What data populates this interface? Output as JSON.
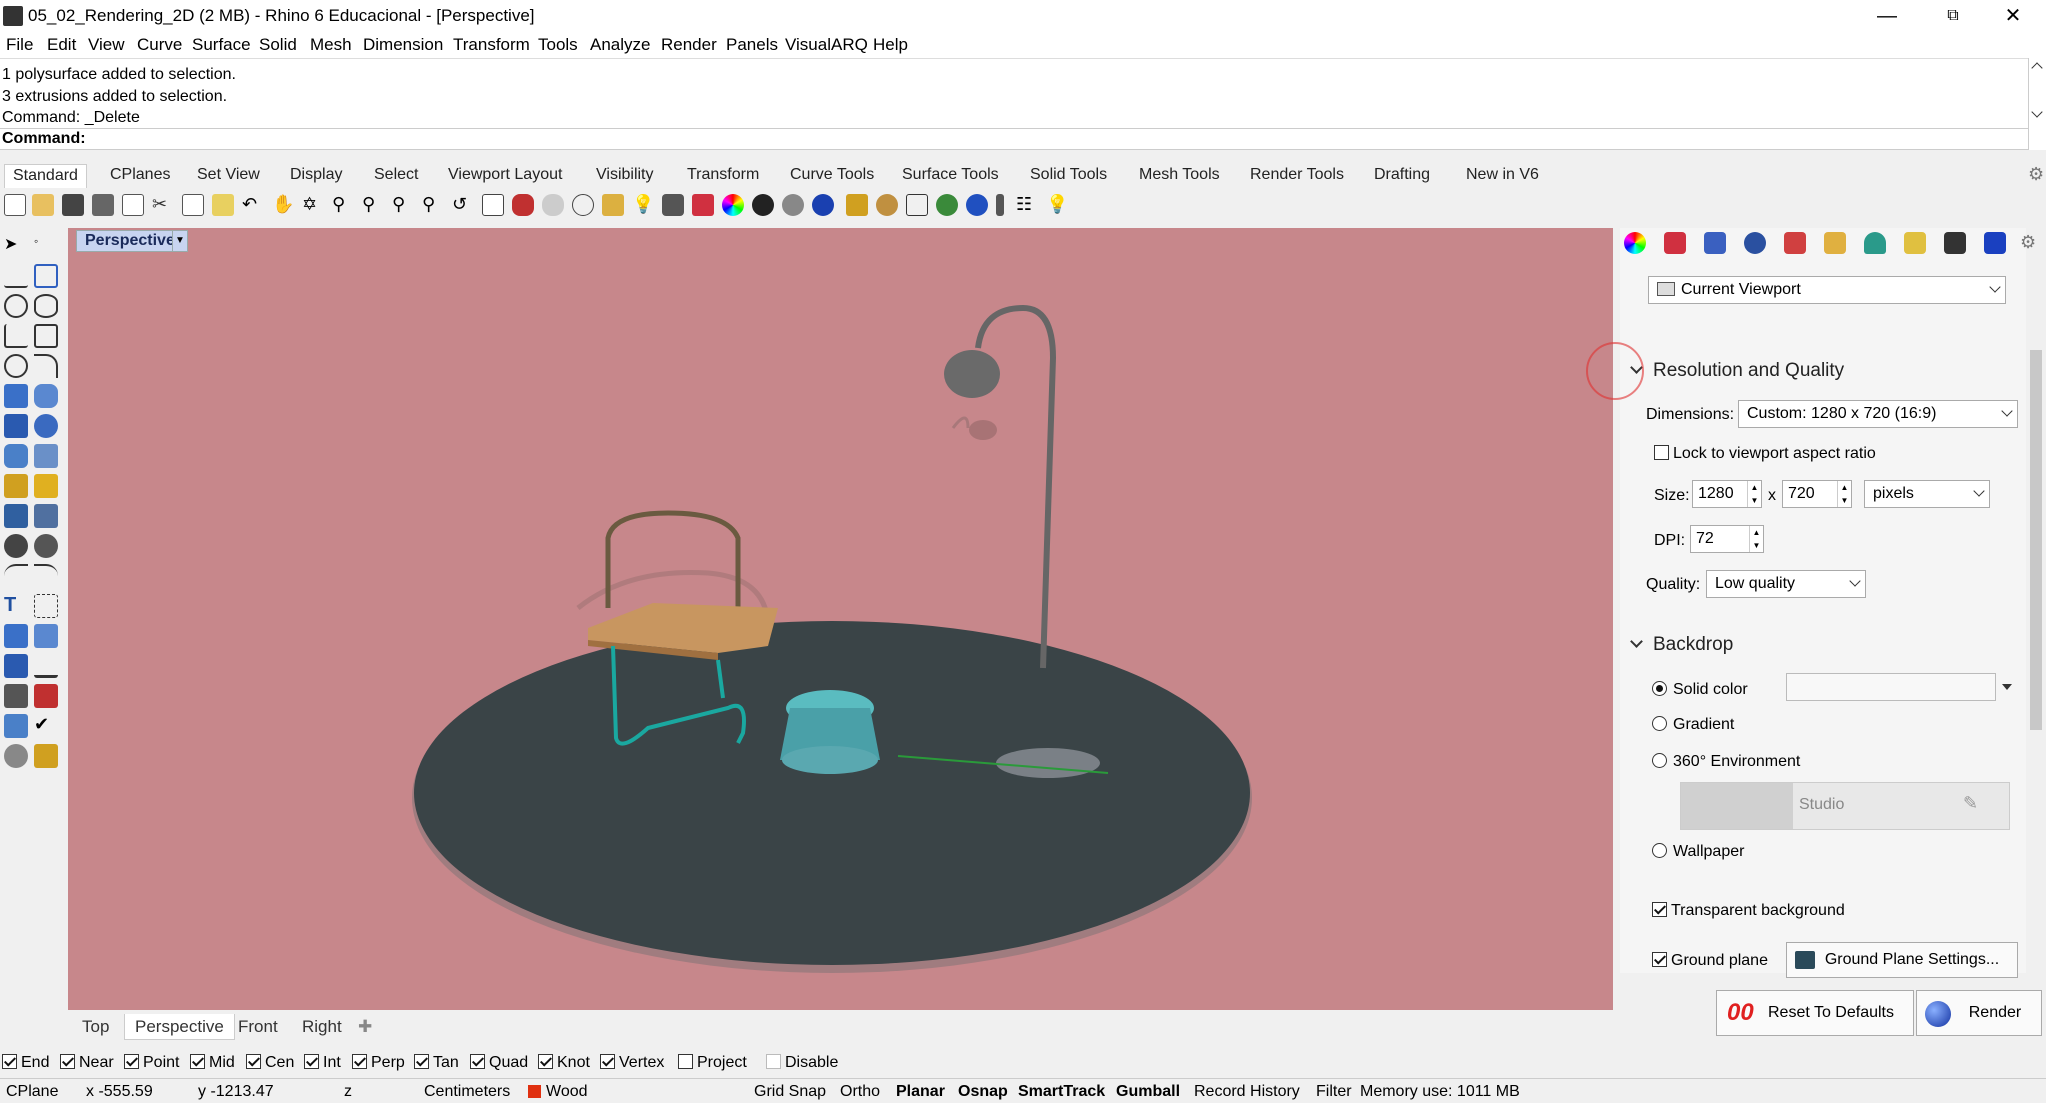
{
  "title": "05_02_Rendering_2D (2 MB) - Rhino 6 Educacional - [Perspective]",
  "menu": [
    "File",
    "Edit",
    "View",
    "Curve",
    "Surface",
    "Solid",
    "Mesh",
    "Dimension",
    "Transform",
    "Tools",
    "Analyze",
    "Render",
    "Panels",
    "VisualARQ",
    "Help"
  ],
  "history": [
    "1 polysurface added to selection.",
    "3 extrusions added to selection.",
    "Command: _Delete"
  ],
  "command_label": "Command:",
  "tabs": [
    "Standard",
    "CPlanes",
    "Set View",
    "Display",
    "Select",
    "Viewport Layout",
    "Visibility",
    "Transform",
    "Curve Tools",
    "Surface Tools",
    "Solid Tools",
    "Mesh Tools",
    "Render Tools",
    "Drafting",
    "New in V6"
  ],
  "viewport": {
    "label": "Perspective"
  },
  "view_tabs": [
    "Top",
    "Perspective",
    "Front",
    "Right"
  ],
  "osnaps": [
    {
      "label": "End",
      "checked": true
    },
    {
      "label": "Near",
      "checked": true
    },
    {
      "label": "Point",
      "checked": true
    },
    {
      "label": "Mid",
      "checked": true
    },
    {
      "label": "Cen",
      "checked": true
    },
    {
      "label": "Int",
      "checked": true
    },
    {
      "label": "Perp",
      "checked": true
    },
    {
      "label": "Tan",
      "checked": true
    },
    {
      "label": "Quad",
      "checked": true
    },
    {
      "label": "Knot",
      "checked": true
    },
    {
      "label": "Vertex",
      "checked": true
    },
    {
      "label": "Project",
      "checked": false
    },
    {
      "label": "Disable",
      "checked": false
    }
  ],
  "status": {
    "cplane": "CPlane",
    "x": "x -555.59",
    "y": "y -1213.47",
    "z": "z",
    "units": "Centimeters",
    "layer": "Wood",
    "layer_color": "#e03010",
    "grid_snap": "Grid Snap",
    "ortho": "Ortho",
    "planar": "Planar",
    "osnap": "Osnap",
    "smarttrack": "SmartTrack",
    "gumball": "Gumball",
    "record_history": "Record History",
    "filter": "Filter",
    "memory": "Memory use: 1011 MB"
  },
  "panel": {
    "source": "Current Viewport",
    "res_title": "Resolution and Quality",
    "dimensions_label": "Dimensions:",
    "dimensions_value": "Custom: 1280 x 720 (16:9)",
    "lock_label": "Lock to viewport aspect ratio",
    "size_label": "Size:",
    "width": "1280",
    "x_sep": "x",
    "height": "720",
    "units": "pixels",
    "dpi_label": "DPI:",
    "dpi": "72",
    "quality_label": "Quality:",
    "quality": "Low quality",
    "backdrop_title": "Backdrop",
    "solid_color": "Solid color",
    "gradient": "Gradient",
    "env360": "360° Environment",
    "studio": "Studio",
    "wallpaper": "Wallpaper",
    "transparent": "Transparent background",
    "ground_plane": "Ground plane",
    "ground_settings": "Ground Plane Settings...",
    "reset": "Reset To Defaults",
    "render": "Render"
  }
}
